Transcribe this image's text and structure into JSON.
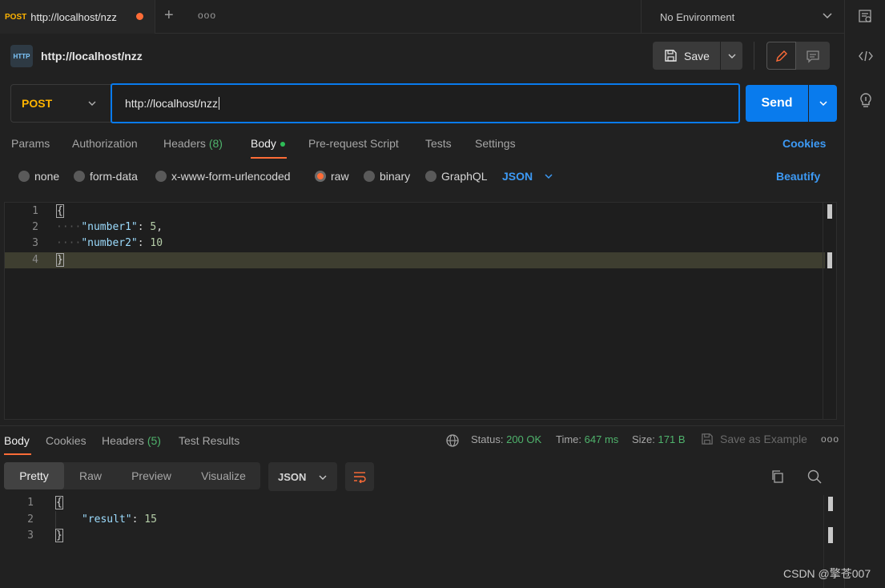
{
  "tabbar": {
    "tab_method": "POST",
    "tab_name": "http://localhost/nzz",
    "plus": "+",
    "more": "ooo",
    "environment": "No Environment"
  },
  "request": {
    "title": "http://localhost/nzz",
    "http_icon_text": "HTTP",
    "save_label": "Save",
    "method": "POST",
    "url": "http://localhost/nzz",
    "send_label": "Send"
  },
  "request_tabs": [
    {
      "label": "Params"
    },
    {
      "label": "Authorization"
    },
    {
      "label": "Headers",
      "count": "(8)"
    },
    {
      "label": "Body"
    },
    {
      "label": "Pre-request Script"
    },
    {
      "label": "Tests"
    },
    {
      "label": "Settings"
    }
  ],
  "cookies_label": "Cookies",
  "body_types": [
    {
      "label": "none"
    },
    {
      "label": "form-data"
    },
    {
      "label": "x-www-form-urlencoded"
    },
    {
      "label": "raw",
      "selected": true
    },
    {
      "label": "binary"
    },
    {
      "label": "GraphQL"
    }
  ],
  "body_format": "JSON",
  "beautify_label": "Beautify",
  "editor": {
    "lines": [
      {
        "num": "1",
        "open": "{"
      },
      {
        "num": "2",
        "key": "\"number1\"",
        "sep": ": ",
        "val": "5",
        "end": ","
      },
      {
        "num": "3",
        "key": "\"number2\"",
        "sep": ": ",
        "val": "10",
        "end": ""
      },
      {
        "num": "4",
        "close": "}"
      }
    ]
  },
  "response": {
    "tabs": [
      {
        "label": "Body"
      },
      {
        "label": "Cookies"
      },
      {
        "label": "Headers",
        "count": "(5)"
      },
      {
        "label": "Test Results"
      }
    ],
    "status_label": "Status:",
    "status_value": "200 OK",
    "time_label": "Time:",
    "time_value": "647 ms",
    "size_label": "Size:",
    "size_value": "171 B",
    "save_example": "Save as Example",
    "more": "ooo",
    "views": [
      "Pretty",
      "Raw",
      "Preview",
      "Visualize"
    ],
    "format": "JSON",
    "lines": [
      {
        "num": "1",
        "open": "{"
      },
      {
        "num": "2",
        "key": "\"result\"",
        "sep": ": ",
        "val": "15"
      },
      {
        "num": "3",
        "close": "}"
      }
    ]
  },
  "watermark": "CSDN @擎苍007"
}
